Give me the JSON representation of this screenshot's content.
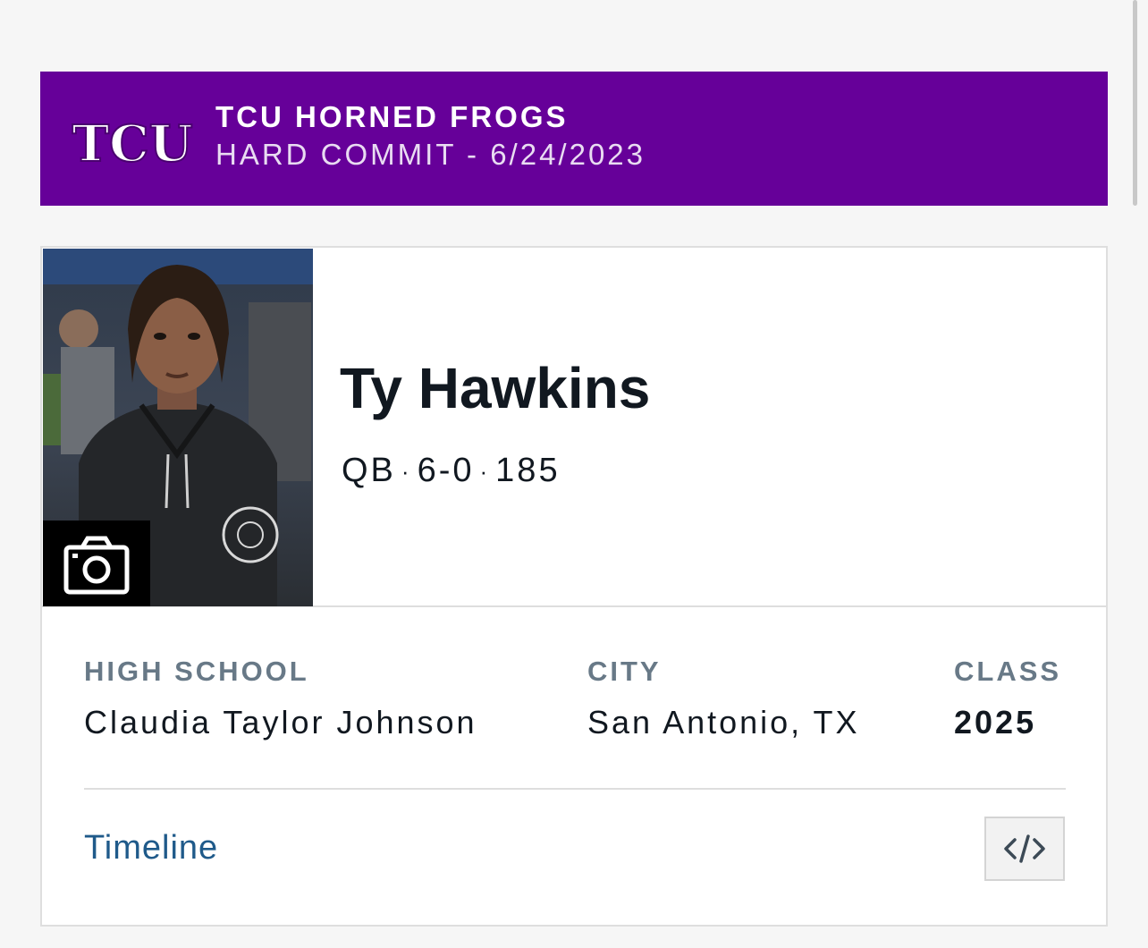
{
  "banner": {
    "team": "TCU HORNED FROGS",
    "commit": "HARD COMMIT - 6/24/2023",
    "logo_text": "TCU",
    "bg_color": "#660099"
  },
  "player": {
    "name": "Ty Hawkins",
    "position": "QB",
    "height": "6-0",
    "weight": "185",
    "separator": "·",
    "photo_icon": "camera-icon"
  },
  "info": {
    "high_school_label": "HIGH SCHOOL",
    "high_school": "Claudia Taylor Johnson",
    "city_label": "CITY",
    "city": "San Antonio, TX",
    "class_label": "CLASS",
    "class": "2025"
  },
  "footer": {
    "timeline_label": "Timeline",
    "embed_icon": "code-icon"
  },
  "colors": {
    "link": "#1f5a8a",
    "label": "#687987",
    "text": "#111820"
  }
}
